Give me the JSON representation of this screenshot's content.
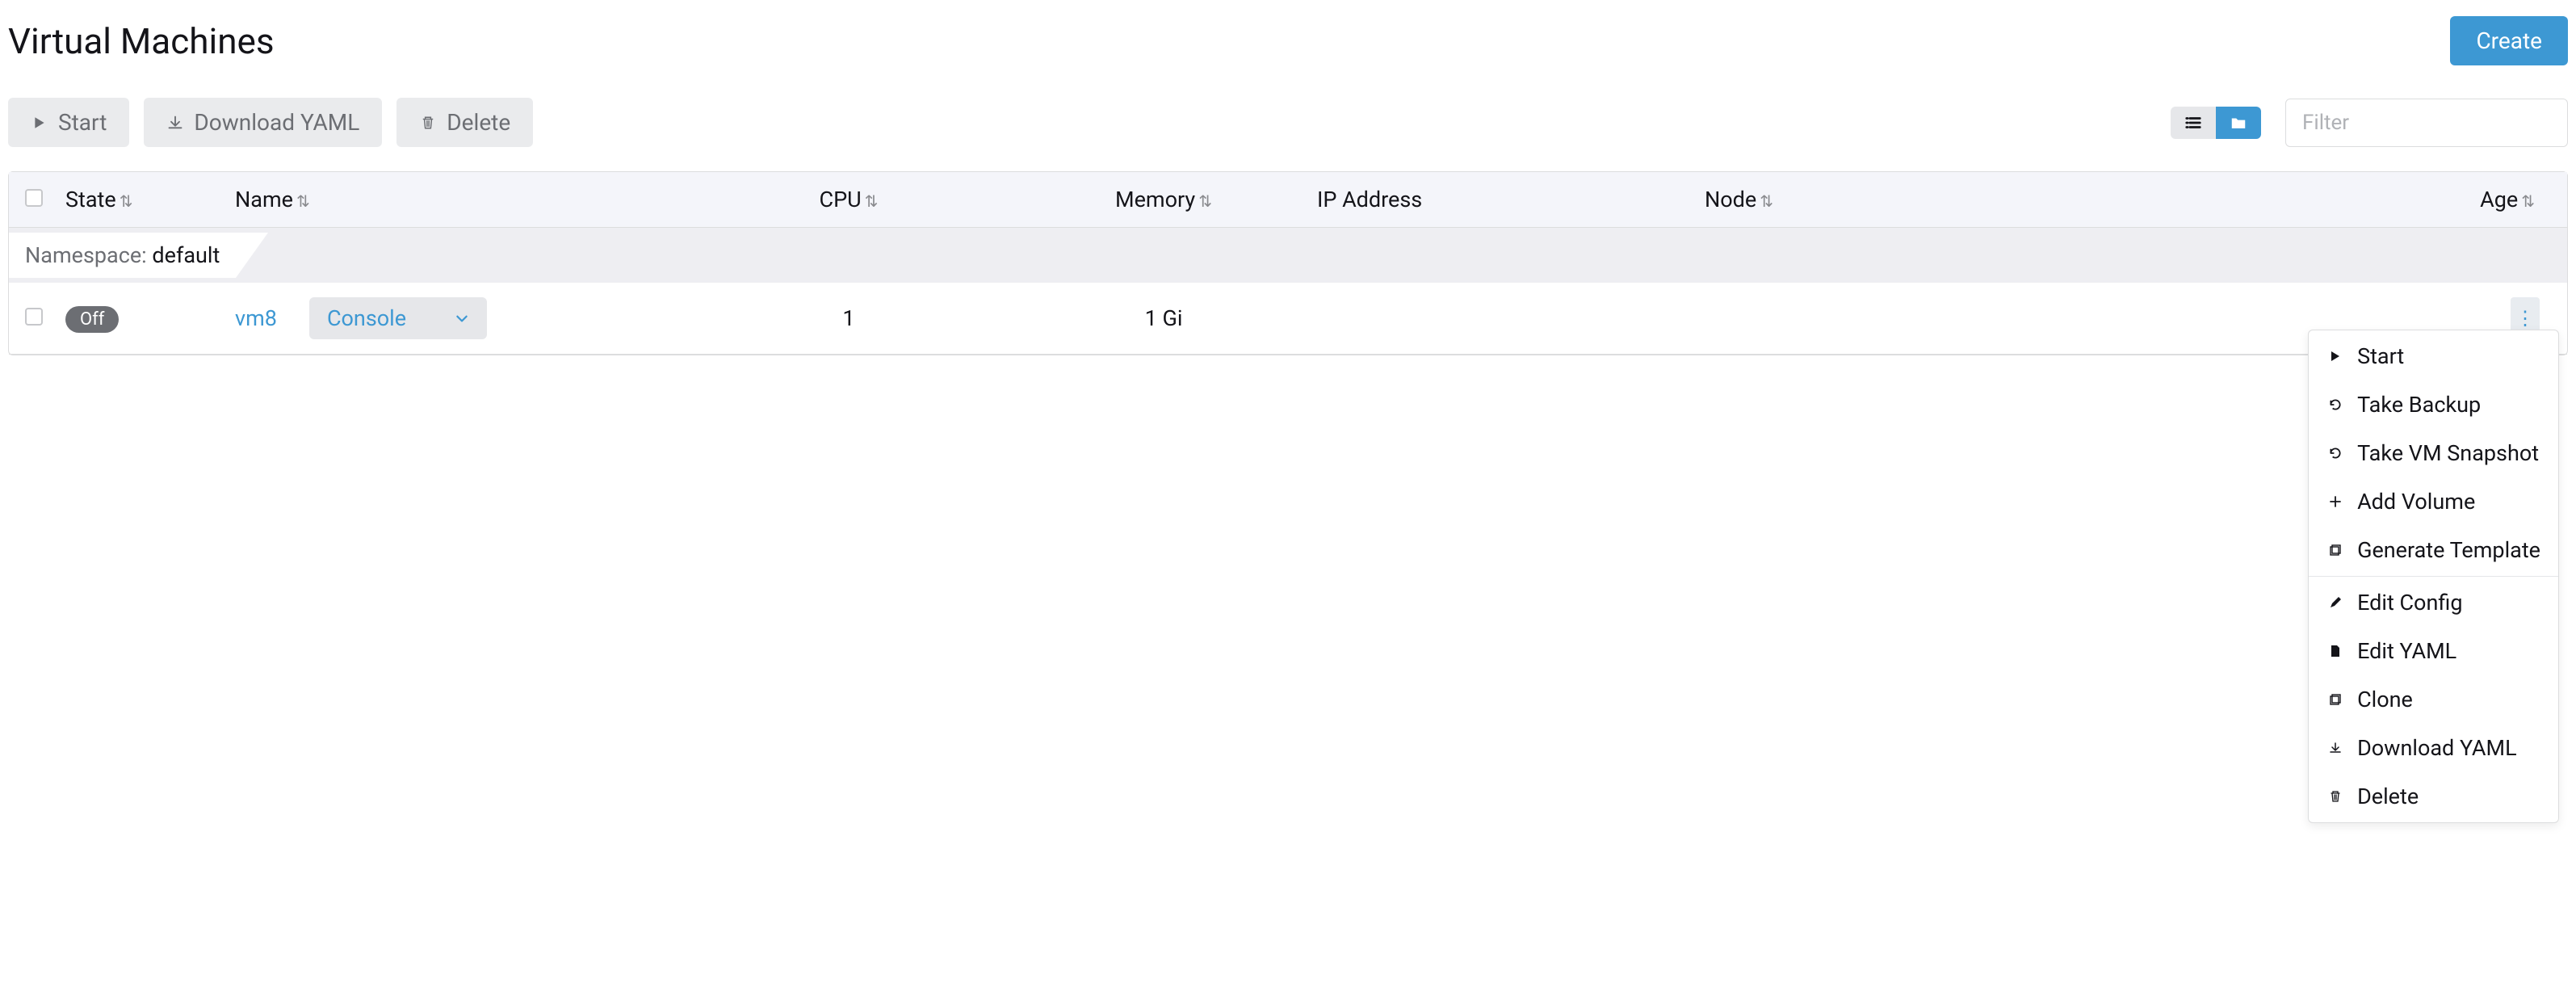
{
  "page": {
    "title": "Virtual Machines",
    "create_label": "Create"
  },
  "toolbar": {
    "start_label": "Start",
    "download_yaml_label": "Download YAML",
    "delete_label": "Delete",
    "filter_placeholder": "Filter"
  },
  "table": {
    "headers": {
      "state": "State",
      "name": "Name",
      "cpu": "CPU",
      "memory": "Memory",
      "ip": "IP Address",
      "node": "Node",
      "age": "Age"
    },
    "namespace": {
      "prefix": "Namespace: ",
      "name": "default"
    },
    "row": {
      "state": "Off",
      "name": "vm8",
      "console_label": "Console",
      "cpu": "1",
      "memory": "1 Gi",
      "ip": "",
      "node": "",
      "age": ""
    }
  },
  "context_menu": {
    "start": "Start",
    "backup": "Take Backup",
    "snapshot": "Take VM Snapshot",
    "add_volume": "Add Volume",
    "gen_template": "Generate Template",
    "edit_config": "Edit Config",
    "edit_yaml": "Edit YAML",
    "clone": "Clone",
    "download_yaml": "Download YAML",
    "delete": "Delete"
  }
}
